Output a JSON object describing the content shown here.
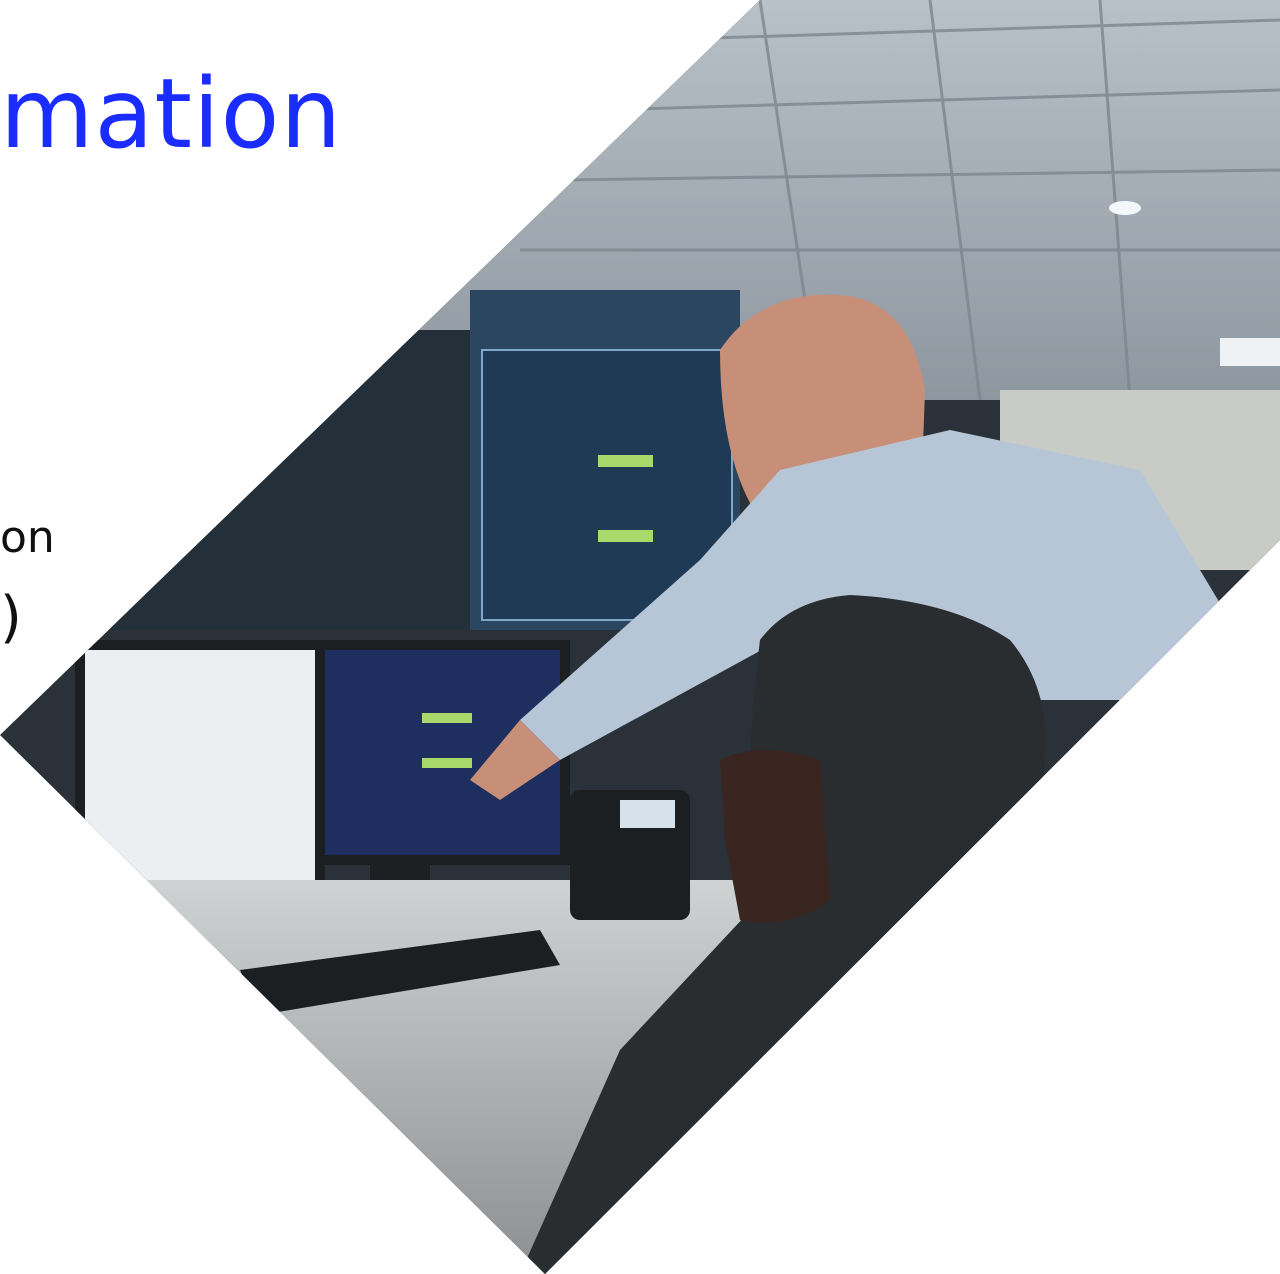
{
  "heading": {
    "title_fragment": "mation"
  },
  "body_text": {
    "line1_fragment": "on",
    "line2_fragment": ")"
  },
  "photo": {
    "subject": "operations-center-photo"
  },
  "colors": {
    "accent": "#1a2cff",
    "text": "#111111",
    "background": "#ffffff"
  }
}
